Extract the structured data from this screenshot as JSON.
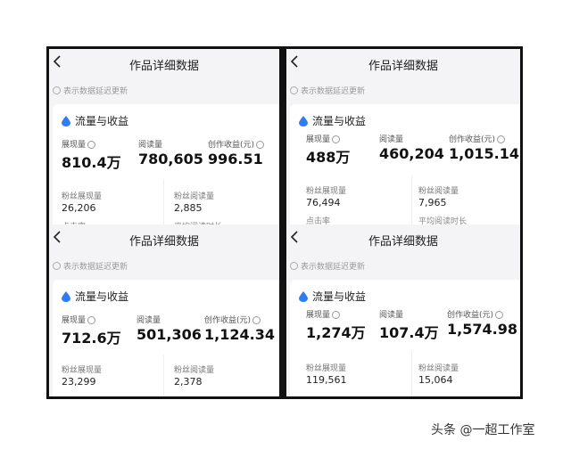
{
  "common": {
    "title": "作品详细数据",
    "delay_note": "表示数据延迟更新",
    "section": "流量与收益",
    "impressions_label": "展现量",
    "reads_label": "阅读量",
    "earnings_label": "创作收益(元)",
    "fan_impressions_label": "粉丝展现量",
    "fan_reads_label": "粉丝阅读量",
    "click_rate_label": "点击率",
    "avg_read_time_label": "平均阅读时长"
  },
  "panels": [
    {
      "impressions": "810.4万",
      "reads": "780,605",
      "earnings": "996.51",
      "fan_impressions": "26,206",
      "fan_reads": "2,885"
    },
    {
      "impressions": "488万",
      "reads": "460,204",
      "earnings": "1,015.14",
      "fan_impressions": "76,494",
      "fan_reads": "7,965"
    },
    {
      "impressions": "712.6万",
      "reads": "501,306",
      "earnings": "1,124.34",
      "fan_impressions": "23,299",
      "fan_reads": "2,378"
    },
    {
      "impressions": "1,274万",
      "reads": "107.4万",
      "earnings": "1,574.98",
      "fan_impressions": "119,561",
      "fan_reads": "15,064"
    }
  ],
  "watermark": "头条 @一超工作室",
  "colors": {
    "accent": "#2f7cf6"
  }
}
